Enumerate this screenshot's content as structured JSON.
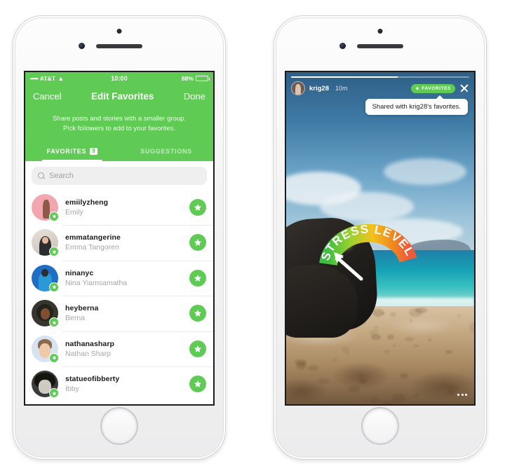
{
  "left_phone": {
    "status_bar": {
      "signal_dots": "•••••",
      "carrier": "AT&T",
      "wifi_icon": "wifi-icon",
      "time": "10:00",
      "battery_text": "88%",
      "battery_level": 88
    },
    "nav": {
      "cancel_label": "Cancel",
      "title": "Edit Favorites",
      "done_label": "Done"
    },
    "banner": {
      "line1": "Share posts and stories with a smaller group.",
      "line2": "Pick followers to add to your favorites."
    },
    "tabs": [
      {
        "label": "FAVORITES",
        "badge": "9",
        "active": true
      },
      {
        "label": "SUGGESTIONS",
        "badge": "",
        "active": false
      }
    ],
    "search": {
      "placeholder": "Search",
      "value": "",
      "icon": "search-icon"
    },
    "people": [
      {
        "username": "emiilyzheng",
        "fullname": "Emily",
        "avatar_class": "a-emily",
        "favorited": true
      },
      {
        "username": "emmatangerine",
        "fullname": "Emma Tangoren",
        "avatar_class": "a-emma",
        "favorited": true
      },
      {
        "username": "ninanyc",
        "fullname": "Nina Yiamsamatha",
        "avatar_class": "a-nina",
        "favorited": true
      },
      {
        "username": "heyberna",
        "fullname": "Berna",
        "avatar_class": "a-berna",
        "favorited": true
      },
      {
        "username": "nathanasharp",
        "fullname": "Nathan Sharp",
        "avatar_class": "a-nathan",
        "favorited": true
      },
      {
        "username": "statueofibberty",
        "fullname": "Ibby",
        "avatar_class": "a-ibby",
        "favorited": true
      }
    ]
  },
  "right_phone": {
    "story": {
      "progress_percent": 60,
      "username": "krig28",
      "timestamp": "10m",
      "favorites_pill_label": "FAVORITES",
      "favorites_pill_icon": "star-icon",
      "close_icon": "close-icon",
      "tooltip_text": "Shared with krig28's favorites.",
      "more_icon": "more-options-icon",
      "sticker": {
        "text": "STRESS LEVEL",
        "type": "gauge-sticker",
        "needle_direction": "upper-left",
        "gradient_stops": [
          "#3fbf3f",
          "#9bd12e",
          "#f2c11c",
          "#f08a1e",
          "#ee5b3a"
        ]
      }
    }
  },
  "colors": {
    "instagram_green": "#5fcb55",
    "white": "#ffffff",
    "text_primary": "#1a1a1a",
    "text_secondary": "#a6a6aa"
  }
}
